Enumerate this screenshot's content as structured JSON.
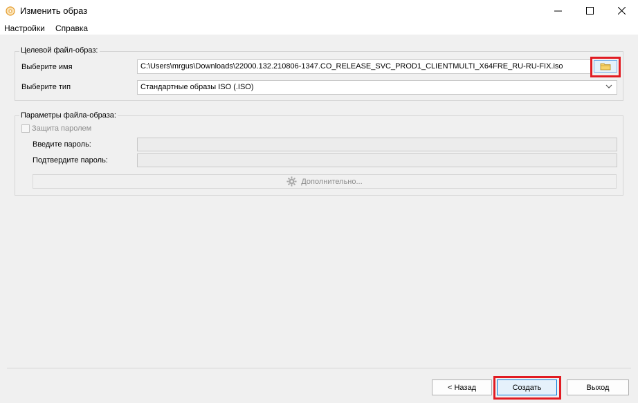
{
  "window": {
    "title": "Изменить образ",
    "icons": {
      "app": "disc-icon",
      "minimize": "minimize-icon",
      "maximize": "maximize-icon",
      "close": "close-icon"
    }
  },
  "menu": {
    "settings": "Настройки",
    "help": "Справка"
  },
  "target_group": {
    "title": "Целевой файл-образ:",
    "name_label": "Выберите имя",
    "name_value": "C:\\Users\\mrgus\\Downloads\\22000.132.210806-1347.CO_RELEASE_SVC_PROD1_CLIENTMULTI_X64FRE_RU-RU-FIX.iso",
    "type_label": "Выберите тип",
    "type_value": "Стандартные образы ISO (.ISO)",
    "browse_icon": "folder-icon"
  },
  "params_group": {
    "title": "Параметры файла-образа:",
    "password_protect_label": "Защита паролем",
    "password_label": "Введите пароль:",
    "confirm_label": "Подтвердите пароль:",
    "advanced_label": "Дополнительно...",
    "advanced_icon": "gear-icon"
  },
  "footer": {
    "back": "< Назад",
    "create": "Создать",
    "exit": "Выход"
  },
  "colors": {
    "highlight": "#e11b22",
    "accent": "#0078d7"
  }
}
